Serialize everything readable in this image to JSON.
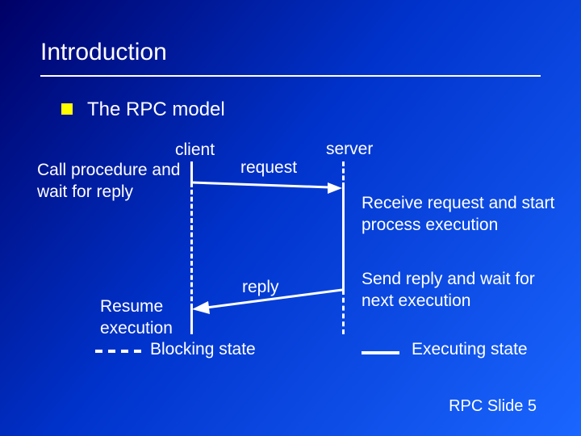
{
  "title": "Introduction",
  "subtitle": "The RPC model",
  "labels": {
    "client": "client",
    "server": "server",
    "call": "Call procedure and wait for reply",
    "request": "request",
    "receive": "Receive request and start process execution",
    "reply": "reply",
    "send": "Send reply and wait for next execution",
    "resume": "Resume execution"
  },
  "legend": {
    "blocking": "Blocking state",
    "executing": "Executing state"
  },
  "footer": "RPC Slide 5"
}
